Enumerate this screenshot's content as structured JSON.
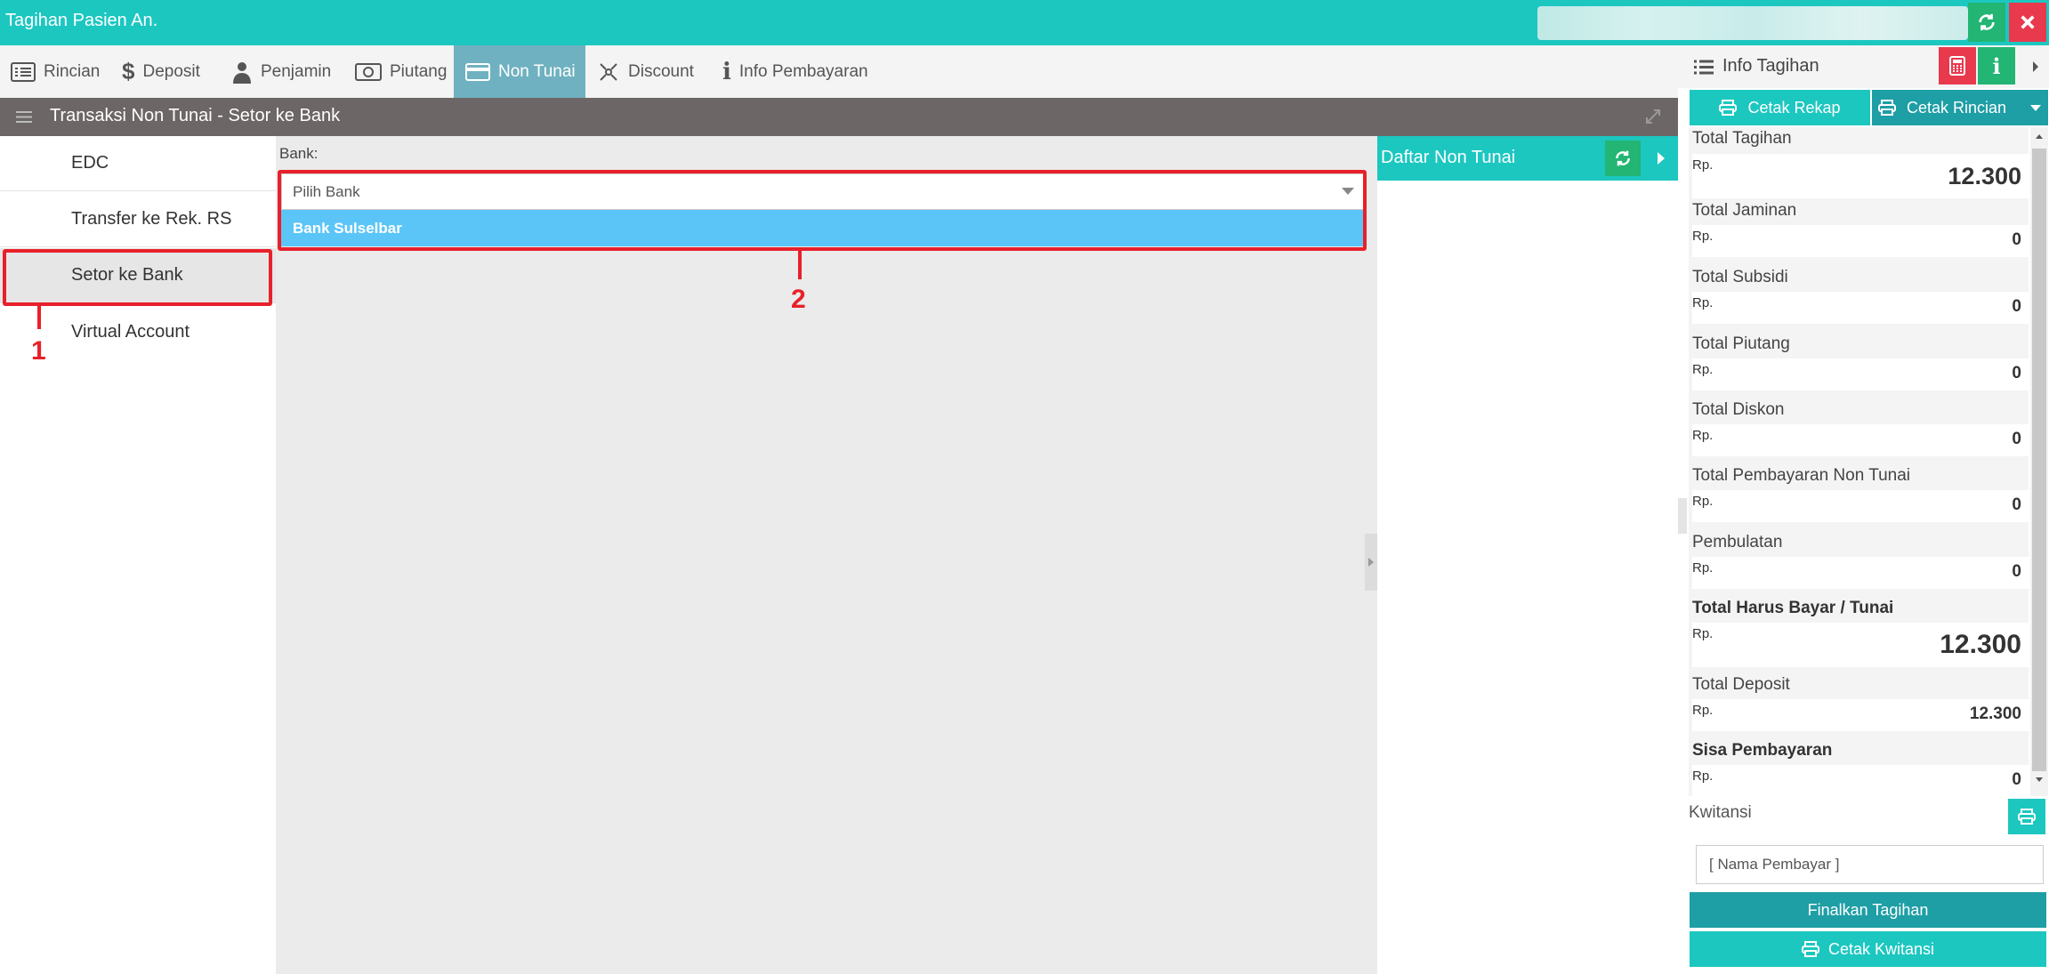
{
  "window": {
    "title": "Tagihan Pasien An."
  },
  "tabs": [
    {
      "label": "Rincian",
      "icon": "list-icon"
    },
    {
      "label": "Deposit",
      "icon": "dollar-icon"
    },
    {
      "label": "Penjamin",
      "icon": "person-icon"
    },
    {
      "label": "Piutang",
      "icon": "money-icon"
    },
    {
      "label": "Non Tunai",
      "icon": "card-icon",
      "active": true
    },
    {
      "label": "Discount",
      "icon": "discount-icon"
    },
    {
      "label": "Info Pembayaran",
      "icon": "info-icon"
    }
  ],
  "section": {
    "title": "Transaksi Non Tunai - Setor ke Bank"
  },
  "menu": [
    {
      "label": "EDC"
    },
    {
      "label": "Transfer ke Rek. RS"
    },
    {
      "label": "Setor ke Bank",
      "selected": true
    },
    {
      "label": "Virtual Account"
    }
  ],
  "form": {
    "bank_label": "Bank:",
    "bank_placeholder": "Pilih Bank",
    "options": [
      "Bank Sulselbar"
    ]
  },
  "annotations": [
    "1",
    "2"
  ],
  "list_panel": {
    "title": "Daftar Non Tunai"
  },
  "info": {
    "title": "Info Tagihan",
    "print_summary": "Cetak Rekap",
    "print_detail": "Cetak Rincian",
    "currency": "Rp.",
    "rows": [
      {
        "label": "Total Tagihan",
        "value": "12.300"
      },
      {
        "label": "Total Jaminan",
        "value": "0"
      },
      {
        "label": "Total Subsidi",
        "value": "0"
      },
      {
        "label": "Total Piutang",
        "value": "0"
      },
      {
        "label": "Total Diskon",
        "value": "0"
      },
      {
        "label": "Total Pembayaran Non Tunai",
        "value": "0"
      },
      {
        "label": "Pembulatan",
        "value": "0"
      },
      {
        "label": "Total Harus Bayar / Tunai",
        "value": "12.300"
      },
      {
        "label": "Total Deposit",
        "value": "12.300"
      },
      {
        "label": "Sisa Pembayaran",
        "value": "0"
      }
    ],
    "receipt_label": "Kwitansi",
    "payer_placeholder": "[ Nama Pembayar ]",
    "finalize": "Finalkan Tagihan",
    "print_receipt": "Cetak Kwitansi"
  },
  "colors": {
    "accent": "#1cc7c0",
    "active_tab": "#6fb1c0",
    "danger": "#e8394d",
    "highlight": "#5bc5f7",
    "annotation": "#e8202a"
  }
}
